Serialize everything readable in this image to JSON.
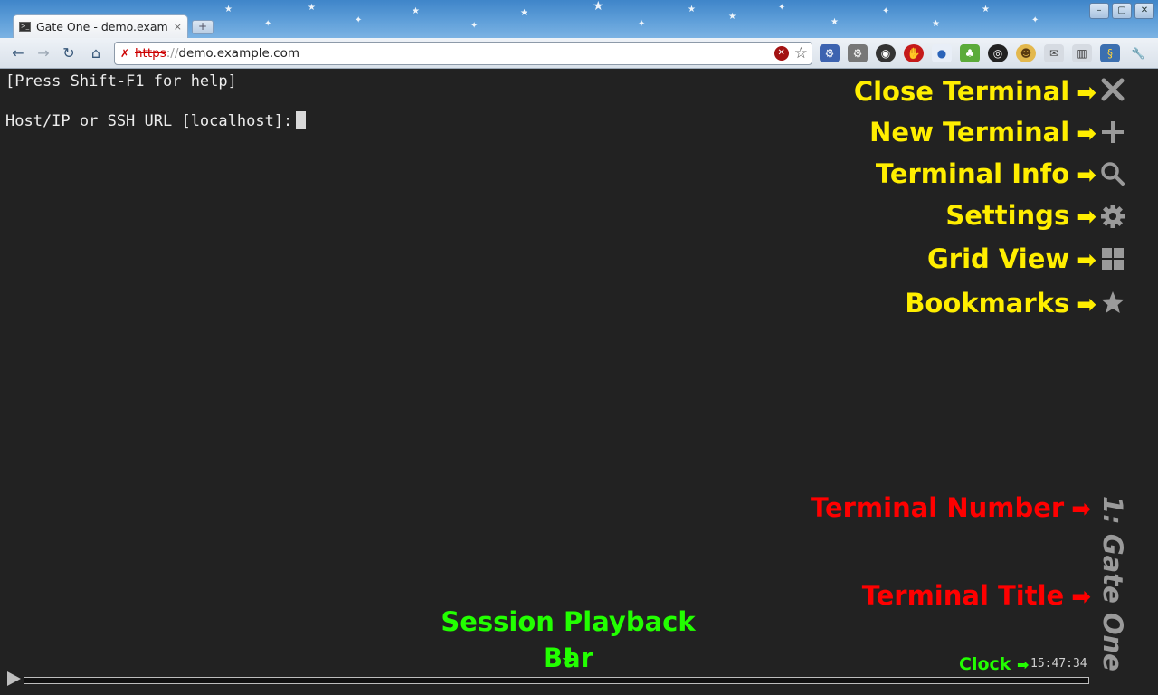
{
  "browser": {
    "tab_title": "Gate One - demo.exam",
    "tab_close": "×",
    "new_tab": "+",
    "window_controls": [
      "–",
      "▢",
      "✕"
    ],
    "nav": {
      "back": "←",
      "forward": "→",
      "reload": "↻",
      "home": "⌂"
    },
    "url_scheme": "https",
    "url_separator": "://",
    "url_host": "demo.example.com",
    "extension_icons": [
      "gear-blue",
      "gear-grey",
      "eye",
      "stop-hand",
      "chat",
      "evernote",
      "color-wheel",
      "face",
      "mail",
      "barcode",
      "python",
      "wrench"
    ]
  },
  "terminal": {
    "help_line": "[Press Shift-F1 for help]",
    "prompt_line": "Host/IP or SSH URL [localhost]:"
  },
  "callouts": {
    "close": "Close Terminal",
    "new": "New Terminal",
    "info": "Terminal Info",
    "settings": "Settings",
    "grid": "Grid View",
    "bookmarks": "Bookmarks",
    "number": "Terminal Number",
    "title": "Terminal Title",
    "playback": "Session Playback Bar",
    "clock": "Clock",
    "arrow_right": "➡",
    "arrow_down": "⬇"
  },
  "terminal_title": "1: Gate One",
  "clock": "15:47:34",
  "colors": {
    "callout_yellow": "#ffee00",
    "callout_red": "#ff0000",
    "callout_green": "#22ff00",
    "terminal_bg": "#222222",
    "icon_grey": "#9a9a9a"
  }
}
